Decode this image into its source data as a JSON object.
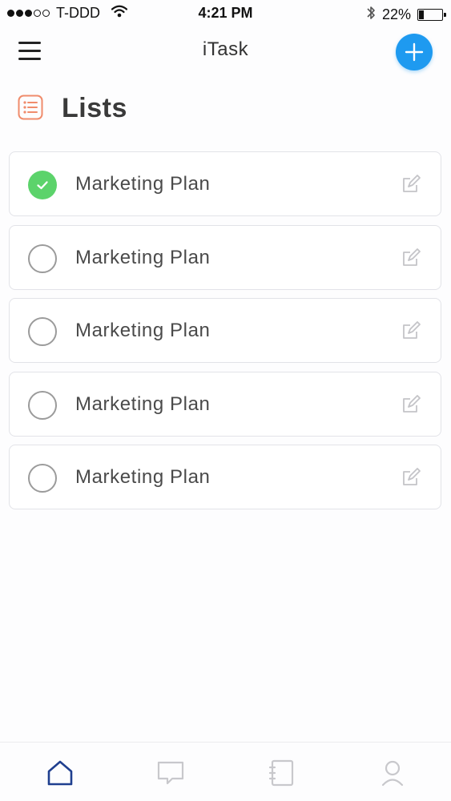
{
  "status_bar": {
    "signal_dots_filled": 3,
    "signal_dots_total": 5,
    "carrier": "T-DDD",
    "time": "4:21 PM",
    "battery_percent": "22%",
    "battery_level": 0.22,
    "icons": [
      "wifi-icon",
      "bluetooth-icon",
      "battery-icon"
    ]
  },
  "header": {
    "title": "iTask",
    "menu_icon": "hamburger-menu-icon",
    "add_icon": "plus-icon",
    "accent_color": "#1e9af0"
  },
  "section": {
    "title": "Lists",
    "icon": "list-icon",
    "icon_color": "#f08c6c"
  },
  "lists": [
    {
      "label": "Marketing Plan",
      "completed": true
    },
    {
      "label": "Marketing Plan",
      "completed": false
    },
    {
      "label": "Marketing Plan",
      "completed": false
    },
    {
      "label": "Marketing Plan",
      "completed": false
    },
    {
      "label": "Marketing Plan",
      "completed": false
    }
  ],
  "colors": {
    "completed_green": "#5cd36b",
    "tab_active": "#1f3f8f",
    "tab_inactive": "#c8c8cc"
  },
  "tabbar": {
    "tabs": [
      {
        "icon": "home-icon",
        "active": true
      },
      {
        "icon": "chat-icon",
        "active": false
      },
      {
        "icon": "notebook-icon",
        "active": false
      },
      {
        "icon": "profile-icon",
        "active": false
      }
    ]
  }
}
